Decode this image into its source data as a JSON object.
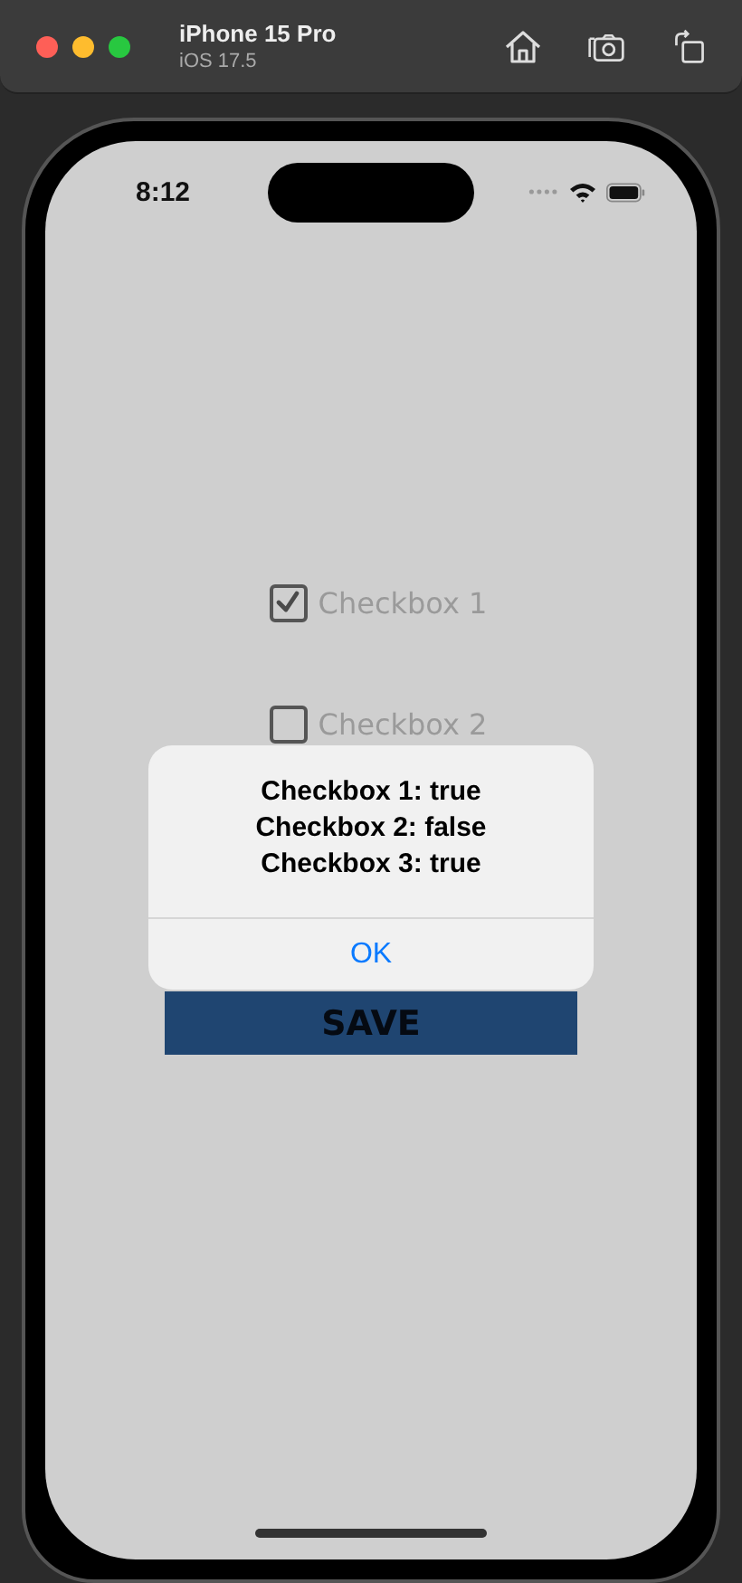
{
  "simulator": {
    "device_name": "iPhone 15 Pro",
    "os_version": "iOS 17.5"
  },
  "status_bar": {
    "time": "8:12"
  },
  "checkboxes": [
    {
      "label": "Checkbox 1",
      "checked": true
    },
    {
      "label": "Checkbox 2",
      "checked": false
    }
  ],
  "save_button": {
    "label": "SAVE"
  },
  "alert": {
    "message": "Checkbox 1: true\nCheckbox 2: false\nCheckbox 3: true",
    "buttons": [
      "OK"
    ]
  }
}
